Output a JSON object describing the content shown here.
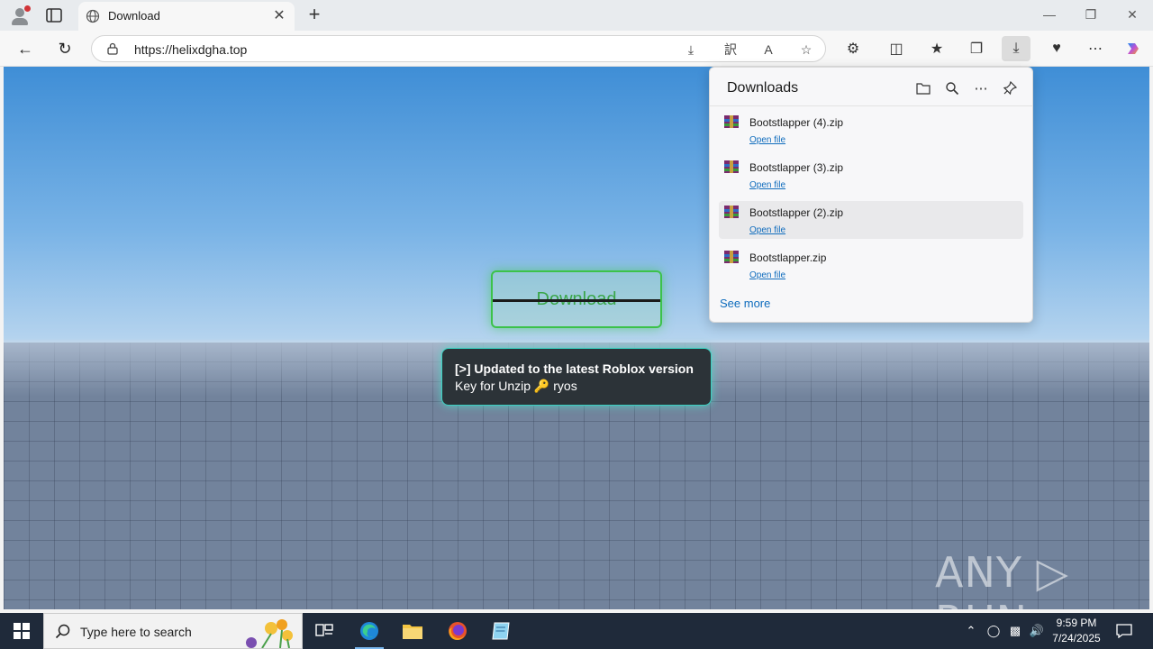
{
  "browser": {
    "tab_title": "Download",
    "url": "https://helixdgha.top",
    "new_tab_symbol": "+",
    "tab_close_symbol": "✕"
  },
  "page": {
    "download_button": "Download",
    "notice_line1": "[>] Updated to the latest Roblox version",
    "notice_line2": "Key for Unzip 🔑 ryos",
    "watermark": "ANY ▷ RUN"
  },
  "downloads_panel": {
    "title": "Downloads",
    "see_more": "See more",
    "items": [
      {
        "name": "Bootstlapper (4).zip",
        "action": "Open file"
      },
      {
        "name": "Bootstlapper (3).zip",
        "action": "Open file"
      },
      {
        "name": "Bootstlapper (2).zip",
        "action": "Open file"
      },
      {
        "name": "Bootstlapper.zip",
        "action": "Open file"
      }
    ]
  },
  "taskbar": {
    "search_placeholder": "Type here to search",
    "time": "9:59 PM",
    "date": "7/24/2025"
  },
  "colors": {
    "accent_green": "#3cc24a",
    "link_blue": "#0f6cbd",
    "notice_glow": "#3ad0c0",
    "taskbar_bg": "#1f2a3a"
  }
}
